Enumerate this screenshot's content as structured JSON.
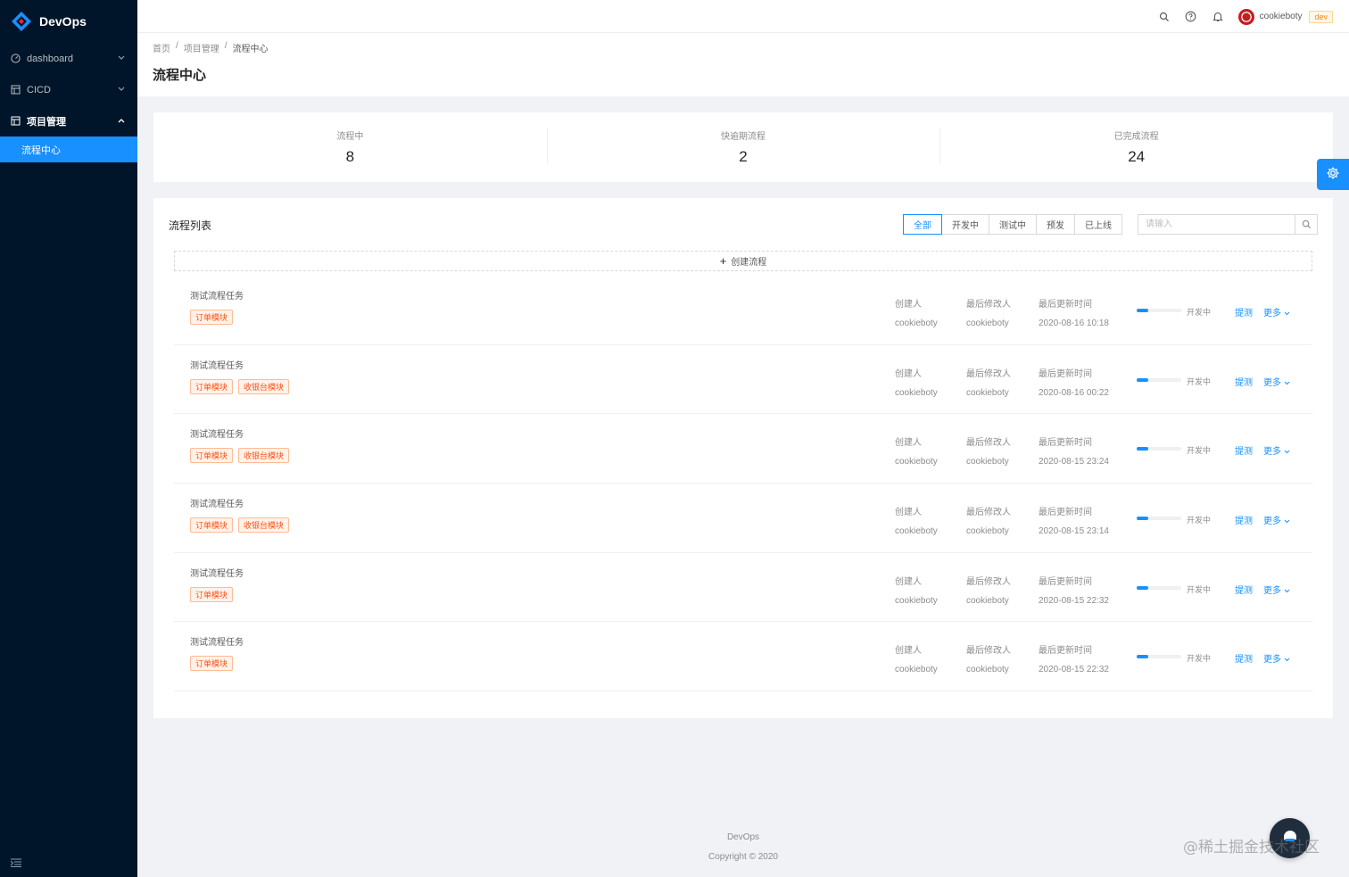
{
  "app": {
    "title": "DevOps"
  },
  "sidebar": {
    "items": [
      {
        "label": "dashboard",
        "icon": "dashboard-icon",
        "expanded": false
      },
      {
        "label": "CICD",
        "icon": "table-icon",
        "expanded": false
      },
      {
        "label": "项目管理",
        "icon": "table-icon",
        "expanded": true
      }
    ],
    "subitems": [
      {
        "label": "流程中心",
        "active": true
      }
    ],
    "collapse_icon": "menu-fold-icon"
  },
  "header": {
    "icons": [
      "search-icon",
      "question-icon",
      "bell-icon"
    ],
    "username": "cookieboty",
    "env": "dev"
  },
  "breadcrumb": [
    "首页",
    "/",
    "项目管理",
    "/",
    "流程中心"
  ],
  "page_title": "流程中心",
  "stats": [
    {
      "label": "流程中",
      "value": "8"
    },
    {
      "label": "快逾期流程",
      "value": "2"
    },
    {
      "label": "已完成流程",
      "value": "24"
    }
  ],
  "list": {
    "title": "流程列表",
    "filters": [
      {
        "label": "全部",
        "active": true
      },
      {
        "label": "开发中",
        "active": false
      },
      {
        "label": "测试中",
        "active": false
      },
      {
        "label": "预发",
        "active": false
      },
      {
        "label": "已上线",
        "active": false
      }
    ],
    "search_placeholder": "请输入",
    "create_label": "创建流程",
    "col_labels": {
      "creator": "创建人",
      "modifier": "最后修改人",
      "updated": "最后更新时间"
    },
    "action_test": "提测",
    "action_more": "更多",
    "rows": [
      {
        "title": "测试流程任务",
        "tags": [
          "订单模块"
        ],
        "creator": "cookieboty",
        "modifier": "cookieboty",
        "updated": "2020-08-16 10:18",
        "progress": 0.25,
        "status": "开发中"
      },
      {
        "title": "测试流程任务",
        "tags": [
          "订单模块",
          "收银台模块"
        ],
        "creator": "cookieboty",
        "modifier": "cookieboty",
        "updated": "2020-08-16 00:22",
        "progress": 0.25,
        "status": "开发中"
      },
      {
        "title": "测试流程任务",
        "tags": [
          "订单模块",
          "收银台模块"
        ],
        "creator": "cookieboty",
        "modifier": "cookieboty",
        "updated": "2020-08-15 23:24",
        "progress": 0.25,
        "status": "开发中"
      },
      {
        "title": "测试流程任务",
        "tags": [
          "订单模块",
          "收银台模块"
        ],
        "creator": "cookieboty",
        "modifier": "cookieboty",
        "updated": "2020-08-15 23:14",
        "progress": 0.25,
        "status": "开发中"
      },
      {
        "title": "测试流程任务",
        "tags": [
          "订单模块"
        ],
        "creator": "cookieboty",
        "modifier": "cookieboty",
        "updated": "2020-08-15 22:32",
        "progress": 0.25,
        "status": "开发中"
      },
      {
        "title": "测试流程任务",
        "tags": [
          "订单模块"
        ],
        "creator": "cookieboty",
        "modifier": "cookieboty",
        "updated": "2020-08-15 22:32",
        "progress": 0.25,
        "status": "开发中"
      }
    ]
  },
  "footer": {
    "line1": "DevOps",
    "line2": "Copyright © 2020"
  },
  "watermark": "@稀土掘金技术社区",
  "colors": {
    "primary": "#1890ff",
    "sider": "#001529",
    "tag": "#fa541c"
  }
}
